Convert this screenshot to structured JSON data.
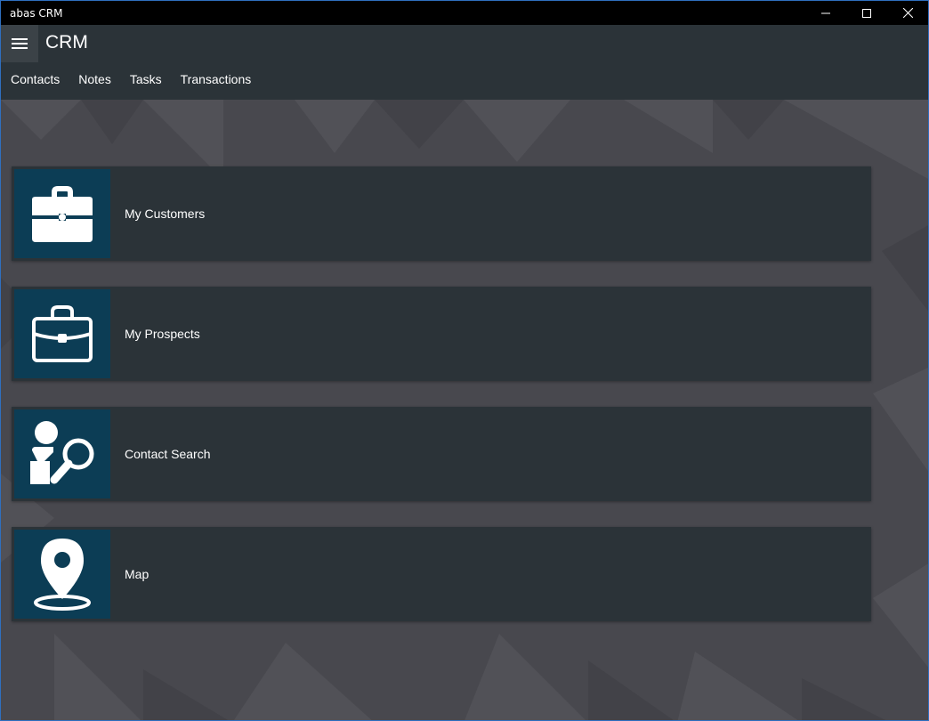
{
  "window": {
    "title": "abas CRM",
    "controls": {
      "minimize_icon": "minimize-icon",
      "maximize_icon": "maximize-icon",
      "close_icon": "close-icon"
    }
  },
  "appbar": {
    "menu_icon": "hamburger-icon",
    "app_name": "CRM",
    "nav": [
      {
        "label": "Contacts"
      },
      {
        "label": "Notes"
      },
      {
        "label": "Tasks"
      },
      {
        "label": "Transactions"
      }
    ]
  },
  "tiles": [
    {
      "label": "My Customers",
      "icon": "briefcase-filled-icon"
    },
    {
      "label": "My Prospects",
      "icon": "briefcase-outline-icon"
    },
    {
      "label": "Contact Search",
      "icon": "person-search-icon"
    },
    {
      "label": "Map",
      "icon": "map-pin-icon"
    }
  ],
  "colors": {
    "titlebar": "#000000",
    "appbar": "#2b3338",
    "tile": "#2b3338",
    "tile_icon_bg": "#0c3d55",
    "content_bg": "#48484e",
    "window_border": "#2f6fbf"
  }
}
